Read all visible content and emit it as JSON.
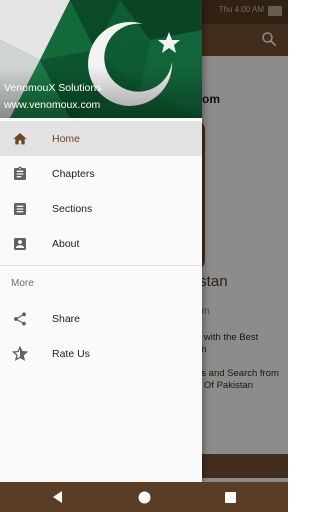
{
  "status_bar": {
    "time": "Thu 4:00 AM"
  },
  "background": {
    "title": "om",
    "heading": "Pakistan",
    "site": "om",
    "text_lines": [
      "n with the Best",
      "gn",
      "",
      "es and Search from",
      "n Of Pakistan"
    ]
  },
  "drawer": {
    "header": {
      "name": "VenomouX Solutions",
      "url": "www.venomoux.com"
    },
    "items": [
      {
        "label": "Home",
        "icon": "home-icon",
        "active": true
      },
      {
        "label": "Chapters",
        "icon": "clipboard-icon",
        "active": false
      },
      {
        "label": "Sections",
        "icon": "list-icon",
        "active": false
      },
      {
        "label": "About",
        "icon": "account-box-icon",
        "active": false
      }
    ],
    "section_title": "More",
    "more_items": [
      {
        "label": "Share",
        "icon": "share-icon"
      },
      {
        "label": "Rate Us",
        "icon": "star-rate-icon"
      }
    ]
  },
  "colors": {
    "primary": "#795233",
    "primary_dark": "#5a3d24",
    "accent_active": "#6d4424",
    "flag_green": "#0f5e33"
  }
}
